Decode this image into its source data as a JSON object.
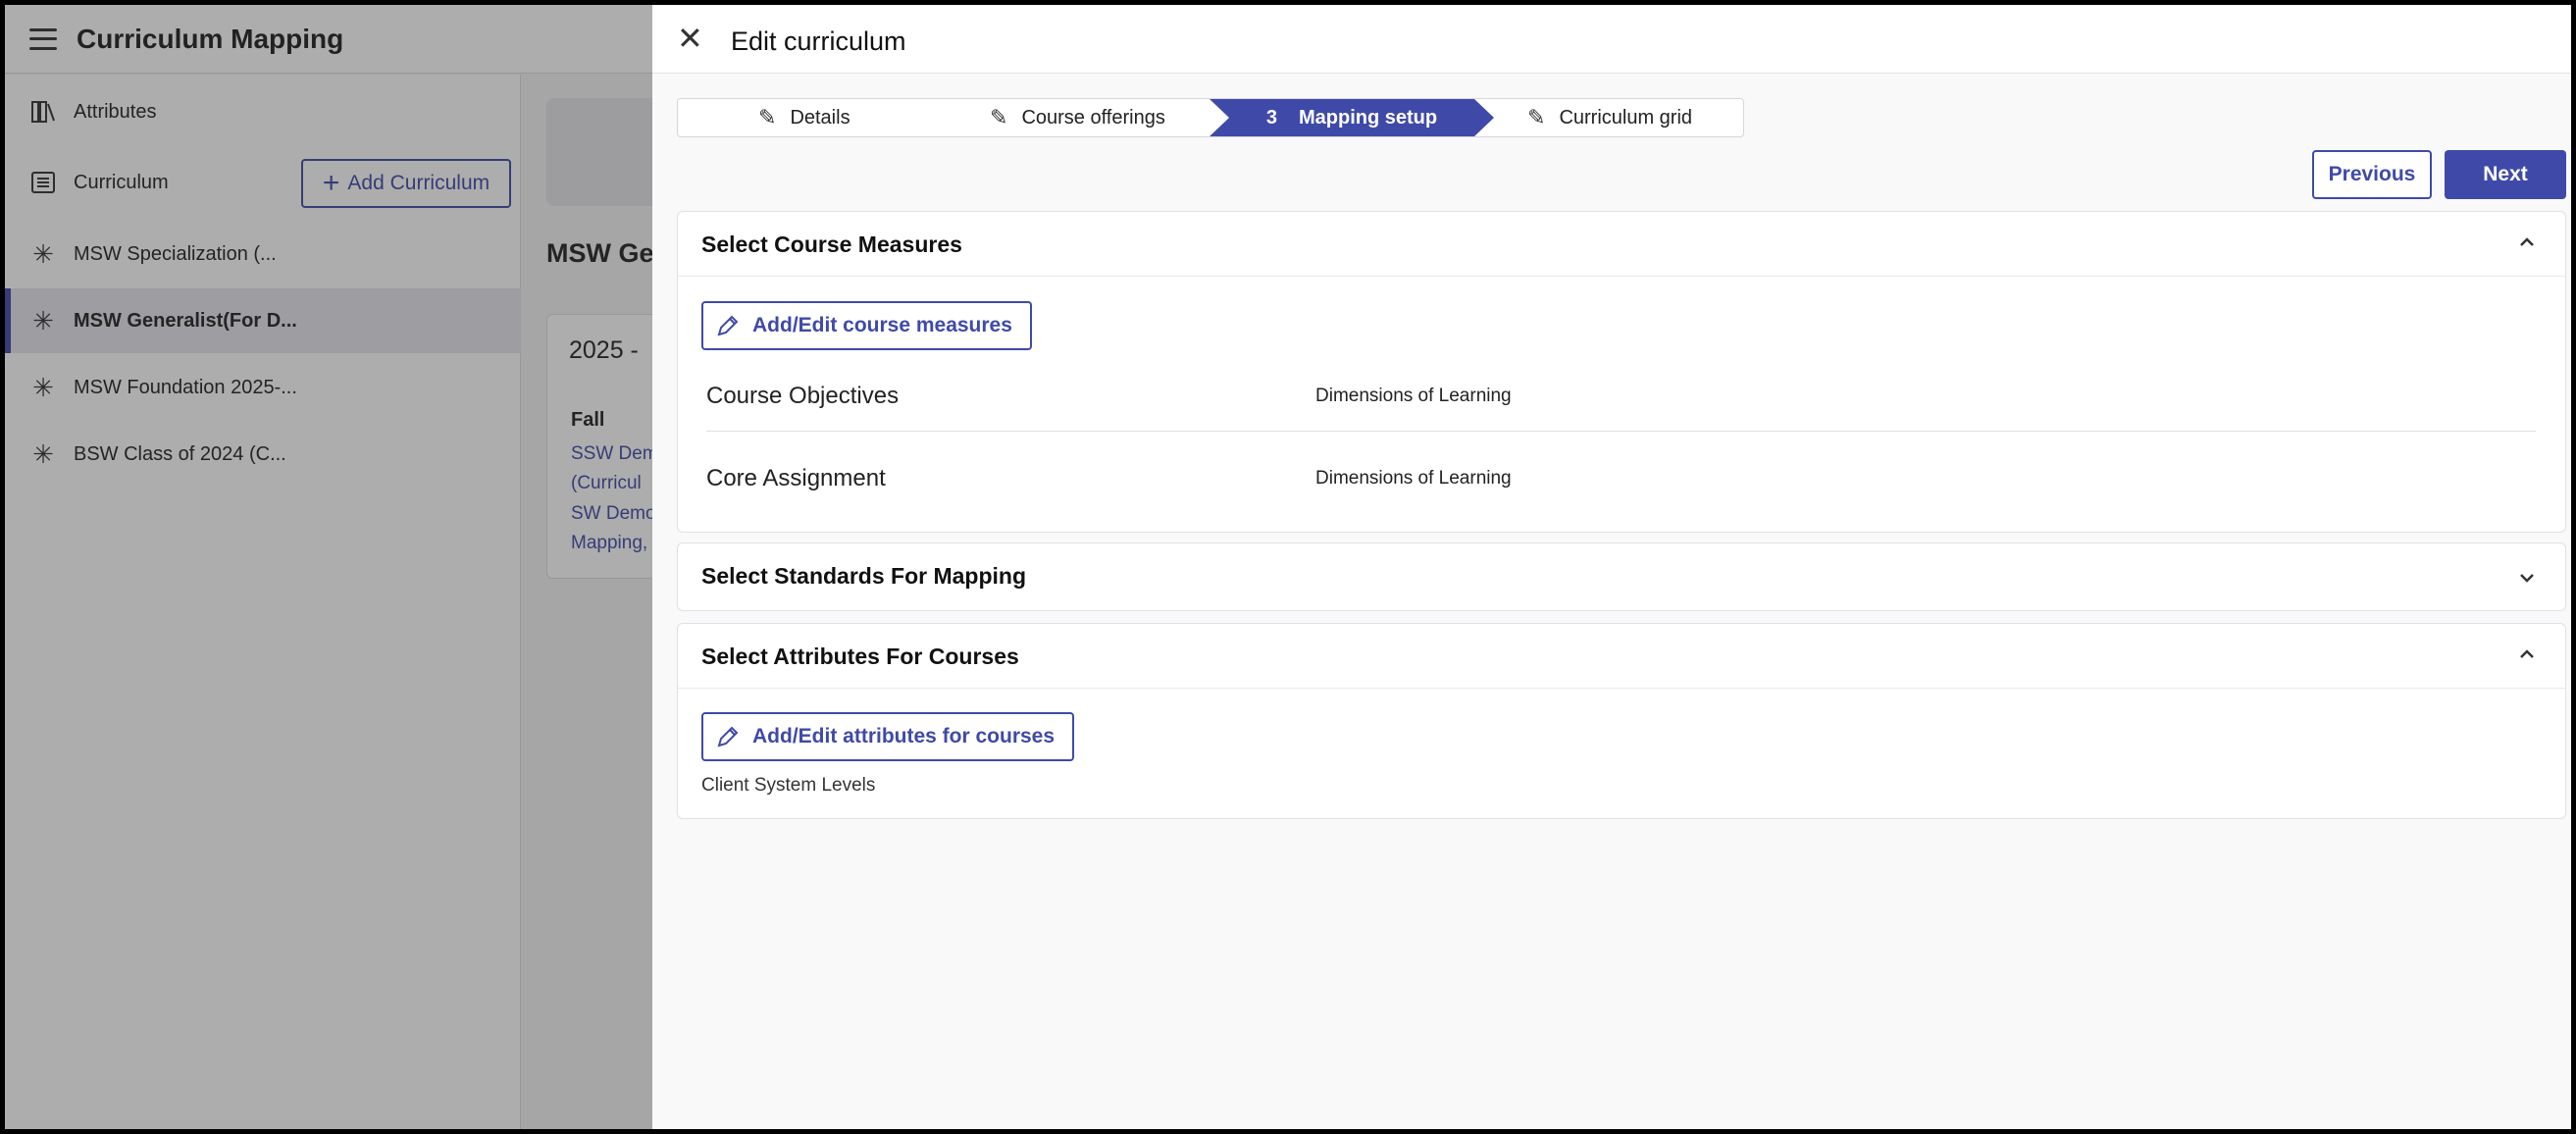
{
  "app": {
    "title": "Curriculum Mapping"
  },
  "left_nav": {
    "attributes_label": "Attributes",
    "curriculum_label": "Curriculum",
    "add_curriculum_label": "Add Curriculum",
    "curricula": [
      {
        "label": "MSW Specialization (...",
        "active": false
      },
      {
        "label": "MSW Generalist(For D...",
        "active": true
      },
      {
        "label": "MSW Foundation 2025-...",
        "active": false
      },
      {
        "label": "BSW Class of 2024 (C...",
        "active": false
      }
    ]
  },
  "main": {
    "title": "MSW Ger",
    "year_title": "2025 -",
    "term": "Fall",
    "links": [
      "SSW Dem",
      "(Curricul",
      "SW Demo",
      "Mapping,"
    ]
  },
  "drawer": {
    "title": "Edit curriculum",
    "steps": [
      {
        "label": "Details",
        "active": false,
        "icon": "pencil-icon"
      },
      {
        "label": "Course offerings",
        "active": false,
        "icon": "pencil-icon"
      },
      {
        "label": "Mapping setup",
        "number": "3",
        "active": true
      },
      {
        "label": "Curriculum grid",
        "active": false,
        "icon": "pencil-icon"
      }
    ],
    "previous_label": "Previous",
    "next_label": "Next",
    "course_measures": {
      "title": "Select Course Measures",
      "expanded": true,
      "edit_label": "Add/Edit course measures",
      "rows": [
        {
          "name": "Course Objectives",
          "value": "Dimensions of Learning"
        },
        {
          "name": "Core Assignment",
          "value": "Dimensions of Learning"
        }
      ]
    },
    "standards": {
      "title": "Select Standards For Mapping",
      "expanded": false
    },
    "attributes": {
      "title": "Select Attributes For Courses",
      "expanded": true,
      "edit_label": "Add/Edit attributes for courses",
      "selected": "Client System Levels"
    }
  },
  "colors": {
    "accent": "#3f4aa8"
  }
}
